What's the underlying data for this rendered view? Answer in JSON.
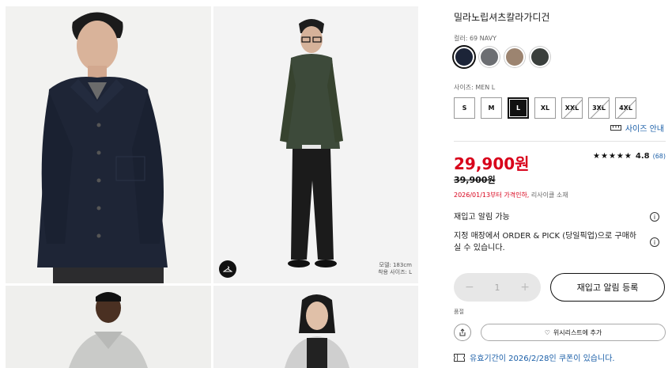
{
  "product": {
    "title": "밀라노립셔츠칼라가디건",
    "color_label": "컬러: 69 NAVY",
    "size_label": "사이즈: MEN L",
    "price": "29,900원",
    "old_price": "39,900원",
    "rating_score": "4.8",
    "rating_count": "(68)",
    "stars": "★★★★★"
  },
  "colors": [
    {
      "name": "navy",
      "hex": "#1c2438",
      "selected": true
    },
    {
      "name": "gray",
      "hex": "#6c6e72",
      "selected": false
    },
    {
      "name": "brown",
      "hex": "#9c8470",
      "selected": false
    },
    {
      "name": "dark-green",
      "hex": "#3a3f3c",
      "selected": false
    }
  ],
  "sizes": [
    {
      "label": "S",
      "state": "available"
    },
    {
      "label": "M",
      "state": "available"
    },
    {
      "label": "L",
      "state": "selected"
    },
    {
      "label": "XL",
      "state": "available"
    },
    {
      "label": "XXL",
      "state": "unavailable"
    },
    {
      "label": "3XL",
      "state": "unavailable"
    },
    {
      "label": "4XL",
      "state": "unavailable"
    }
  ],
  "size_guide": "사이즈 안내",
  "notice": {
    "red": "2026/01/13부터 가격인하,",
    "gray": "리사이클 소재"
  },
  "restock_available": "재입고 알림 가능",
  "pickup_text": "지정 매장에서 ORDER & PICK (당일픽업)으로 구매하실 수 있습니다.",
  "info_icon": "i",
  "quantity": {
    "minus": "−",
    "value": "1",
    "plus": "+"
  },
  "restock_button": "재입고 알림 등록",
  "small_label": "품절",
  "wishlist": {
    "icon": "♡",
    "label": "위시리스트에 추가"
  },
  "coupon_text": "유효기간이 2026/2/28인 쿠폰이 있습니다.",
  "model_info": {
    "line1": "모델: 183cm",
    "line2": "착용 사이즈: L"
  },
  "icons": {
    "hanger": "hanger-icon",
    "ruler": "ruler-icon",
    "share": "share-icon",
    "coupon": "coupon-icon"
  }
}
